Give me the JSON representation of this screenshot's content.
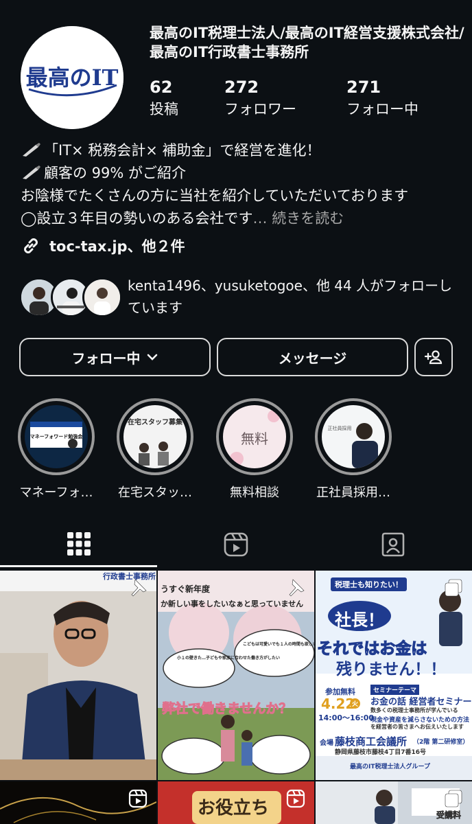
{
  "profile": {
    "name": "最高のIT税理士法人/最高のIT経営支援株式会社/最高のIT行政書士事務所",
    "avatar_text": "最高のIT",
    "stats": [
      {
        "value": "62",
        "label": "投稿"
      },
      {
        "value": "272",
        "label": "フォロワー"
      },
      {
        "value": "271",
        "label": "フォロー中"
      }
    ]
  },
  "bio": {
    "line1": "「IT× 税務会計× 補助金」で経営を進化！",
    "line2": "顧客の 99% がご紹介",
    "line3": "お陰様でたくさんの方に当社を紹介していただいております",
    "line4": "◯設立３年目の勢いのある会社です",
    "more": "… 続きを読む",
    "link": "toc-tax.jp、他２件"
  },
  "followed_by": {
    "text": "kenta1496、yusuketogoe、他 44 人がフォローしています"
  },
  "actions": {
    "following": "フォロー中",
    "message": "メッセージ"
  },
  "highlights": [
    {
      "label": "マネーフォ…",
      "thumb_text": "マネーフォワード勉強会"
    },
    {
      "label": "在宅スタッ…",
      "thumb_text": "在宅スタッフ募集"
    },
    {
      "label": "無料相談",
      "thumb_text": "無料"
    },
    {
      "label": "正社員採用…",
      "thumb_text": "正社員採用"
    }
  ],
  "tabs": [
    "grid",
    "reels",
    "tagged"
  ],
  "posts": [
    {
      "caption": "行政書士事務所"
    },
    {
      "caption_top": "うすぐ新年度",
      "caption_sub": "か新しい事をしたいなぁと思っていません",
      "headline": "弊社で働きませんか？",
      "bubble1": "小１の壁きた…子どもや家族に合わせた働き方がしたい",
      "bubble2": "こどもは可愛いでも１人の時間も欲しい（毎日お昼作りたくない）"
    },
    {
      "ribbon": "税理士も知りたい！",
      "h1": "社長！",
      "h2": "それではお金は",
      "h3": "残りません！！",
      "free": "参加無料",
      "date": "4.22",
      "dow": "火",
      "time": "14:00〜16:00",
      "theme_tag": "セミナーテーマ",
      "theme": "お金の話 経営者セミナー",
      "desc1": "数多くの税理士事務所が学んでいる",
      "desc2": "現金や資産を減らさないための方法",
      "desc3": "を経営者の皆さまへお伝えいたします",
      "venue_lbl": "会場",
      "venue": "藤枝商工会議所",
      "venue_room": "（2階 第二研修室）",
      "address": "静岡県藤枝市藤枝4丁目7番16号",
      "org": "最高のIT税理士法人グループ"
    },
    {
      "caption": ""
    },
    {
      "caption": "お役立ち"
    },
    {
      "caption": "受講料"
    }
  ],
  "colors": {
    "background": "#0c1014",
    "brand_blue": "#1f3b8f",
    "text": "#f5f5f5",
    "muted": "#a8a8a8"
  }
}
